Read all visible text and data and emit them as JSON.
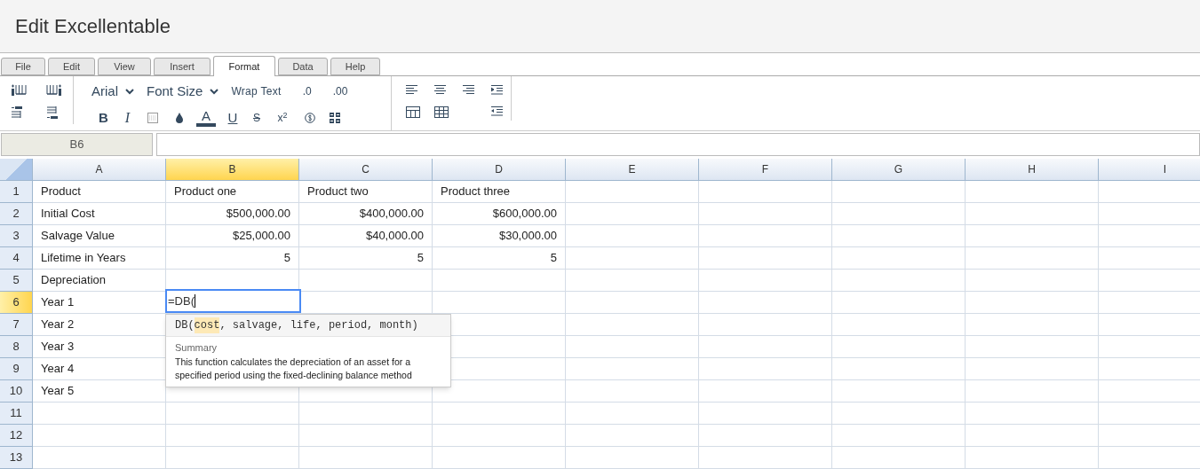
{
  "title": "Edit Excellentable",
  "menu_tabs": [
    {
      "label": "File",
      "selected": false
    },
    {
      "label": "Edit",
      "selected": false
    },
    {
      "label": "View",
      "selected": false
    },
    {
      "label": "Insert",
      "selected": false
    },
    {
      "label": "Format",
      "selected": true
    },
    {
      "label": "Data",
      "selected": false
    },
    {
      "label": "Help",
      "selected": false
    }
  ],
  "toolbar": {
    "font": "Arial",
    "font_size": "Font Size",
    "wrap_text": "Wrap Text",
    "decimals": [
      ".0",
      ".00"
    ],
    "bold": "B",
    "italic": "I",
    "font_color": "A",
    "underline": "U",
    "strikethrough": "S",
    "superscript": "x$^{2}$"
  },
  "name_box": "B6",
  "columns": [
    {
      "label": "A",
      "selected": false
    },
    {
      "label": "B",
      "selected": true
    },
    {
      "label": "C",
      "selected": false
    },
    {
      "label": "D",
      "selected": false
    },
    {
      "label": "E",
      "selected": false
    },
    {
      "label": "F",
      "selected": false
    },
    {
      "label": "G",
      "selected": false
    },
    {
      "label": "H",
      "selected": false
    },
    {
      "label": "I",
      "selected": false
    }
  ],
  "rows": [
    {
      "label": "1",
      "selected": false,
      "numeric": false,
      "cells": [
        "Product",
        "Product one",
        "Product two",
        "Product three"
      ]
    },
    {
      "label": "2",
      "selected": false,
      "numeric": true,
      "cells": [
        "Initial Cost",
        "$500,000.00",
        "$400,000.00",
        "$600,000.00"
      ]
    },
    {
      "label": "3",
      "selected": false,
      "numeric": true,
      "cells": [
        "Salvage Value",
        "$25,000.00",
        "$40,000.00",
        "$30,000.00"
      ]
    },
    {
      "label": "4",
      "selected": false,
      "numeric": true,
      "cells": [
        "Lifetime in Years",
        "5",
        "5",
        "5"
      ]
    },
    {
      "label": "5",
      "selected": false,
      "cells": [
        "Depreciation"
      ]
    },
    {
      "label": "6",
      "selected": true,
      "cells": [
        "Year 1"
      ]
    },
    {
      "label": "7",
      "selected": false,
      "cells": [
        "Year 2"
      ]
    },
    {
      "label": "8",
      "selected": false,
      "cells": [
        "Year 3"
      ]
    },
    {
      "label": "9",
      "selected": false,
      "cells": [
        "Year 4"
      ]
    },
    {
      "label": "10",
      "selected": false,
      "cells": [
        "Year 5"
      ]
    },
    {
      "label": "11",
      "selected": false,
      "cells": []
    },
    {
      "label": "12",
      "selected": false,
      "cells": []
    },
    {
      "label": "13",
      "selected": false,
      "cells": []
    }
  ],
  "editor": {
    "value": "=DB("
  },
  "hint": {
    "function": "DB(",
    "params": [
      {
        "text": "cost",
        "selected": true
      },
      {
        "text": "salvage",
        "selected": false
      },
      {
        "text": "life",
        "selected": false
      },
      {
        "text": "period",
        "selected": false
      },
      {
        "text": "month",
        "selected": false
      }
    ],
    "separator": ", ",
    "close": ")",
    "summary_label": "Summary",
    "summary": "This function calculates the depreciation of an asset for a specified period using the fixed-declining balance method"
  }
}
